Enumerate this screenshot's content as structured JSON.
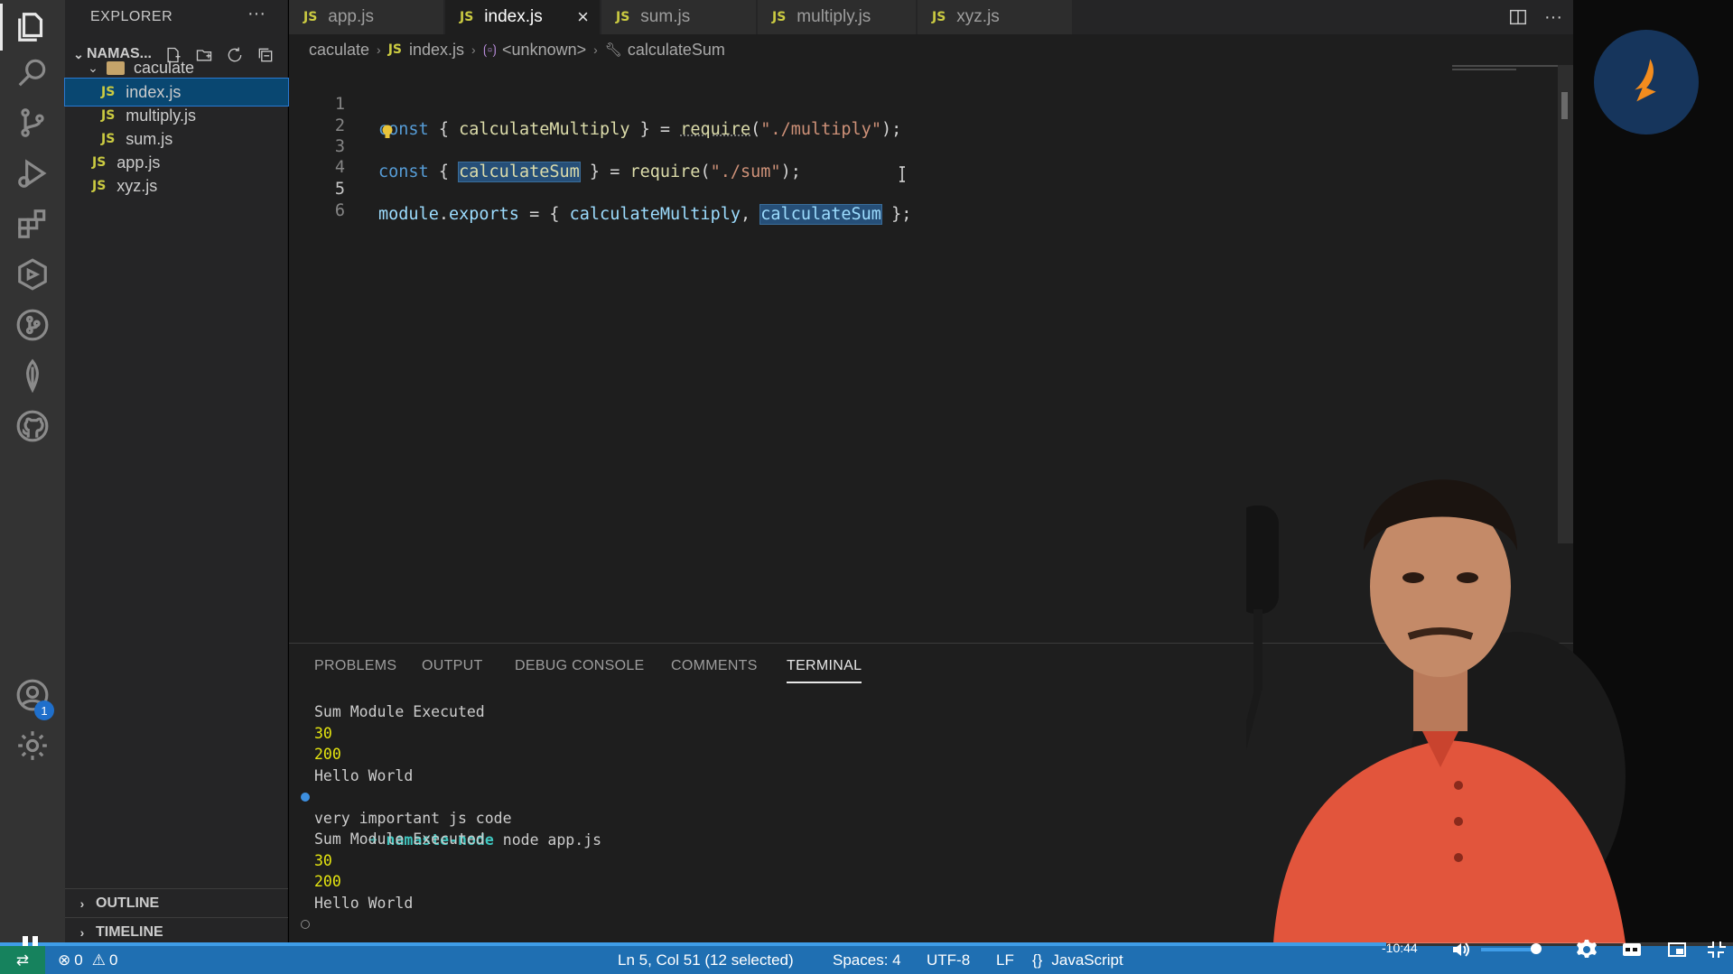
{
  "explorer": {
    "title": "EXPLORER",
    "more": "···",
    "root_label": "NAMAS...",
    "folder_label": "caculate",
    "file_tag": "JS",
    "files": [
      {
        "label": "index.js",
        "selected": true,
        "depth": 2
      },
      {
        "label": "multiply.js",
        "selected": false,
        "depth": 2
      },
      {
        "label": "sum.js",
        "selected": false,
        "depth": 2
      },
      {
        "label": "app.js",
        "selected": false,
        "depth": 1
      },
      {
        "label": "xyz.js",
        "selected": false,
        "depth": 1
      }
    ],
    "outline_label": "OUTLINE",
    "timeline_label": "TIMELINE"
  },
  "activity": {
    "account_badge": "1"
  },
  "tabs": [
    {
      "label": "app.js",
      "active": false
    },
    {
      "label": "index.js",
      "active": true
    },
    {
      "label": "sum.js",
      "active": false
    },
    {
      "label": "multiply.js",
      "active": false
    },
    {
      "label": "xyz.js",
      "active": false
    }
  ],
  "tab_close": "×",
  "tab_more": "···",
  "breadcrumb": {
    "folder": "caculate",
    "file": "index.js",
    "scope": "<unknown>",
    "symbol": "calculateSum"
  },
  "editor": {
    "line_numbers": [
      "1",
      "2",
      "3",
      "4",
      "5",
      "6"
    ],
    "line1": {
      "kw": "const",
      "p1": " { ",
      "id": "calculateMultiply",
      "p2": " } = ",
      "fn": "require",
      "p3": "(",
      "str": "\"./multiply\"",
      "p4": ");"
    },
    "line3": {
      "kw": "const",
      "p1": " { ",
      "id": "calculateSum",
      "p2": " } = ",
      "fn": "require",
      "p3": "(",
      "str": "\"./sum\"",
      "p4": ");"
    },
    "line5": {
      "id1": "module",
      "dot": ".",
      "id2": "exports",
      "p1": " = { ",
      "id3": "calculateMultiply",
      "p2": ", ",
      "id4": "calculateSum",
      "p3": " };"
    }
  },
  "panel": {
    "tabs": [
      "PROBLEMS",
      "OUTPUT",
      "DEBUG CONSOLE",
      "COMMENTS",
      "TERMINAL"
    ],
    "active_tab": "TERMINAL",
    "terminal": [
      {
        "text": "Sum Module Executed",
        "yellow": false
      },
      {
        "text": "30",
        "yellow": true
      },
      {
        "text": "200",
        "yellow": true
      },
      {
        "text": "Hello World",
        "yellow": false
      }
    ],
    "prompt_arrow": "➜",
    "prompt_dir": "namaste-node",
    "command": "node app.js",
    "terminal_after": [
      {
        "text": "very important js code",
        "yellow": false
      },
      {
        "text": "Sum Module Executed",
        "yellow": false
      },
      {
        "text": "30",
        "yellow": true
      },
      {
        "text": "200",
        "yellow": true
      },
      {
        "text": "Hello World",
        "yellow": false
      }
    ]
  },
  "statusbar": {
    "errors": "0",
    "warnings": "0",
    "position": "Ln 5, Col 51 (12 selected)",
    "spaces": "Spaces: 4",
    "encoding": "UTF-8",
    "eol": "LF",
    "language": "JavaScript",
    "language_braces": "{}"
  },
  "player": {
    "time": "-10:44",
    "progress": 0.8,
    "volume": 0.8
  },
  "colors": {
    "accent": "#1f6fb2",
    "selection": "#094771",
    "js_icon": "#cbcb41"
  }
}
